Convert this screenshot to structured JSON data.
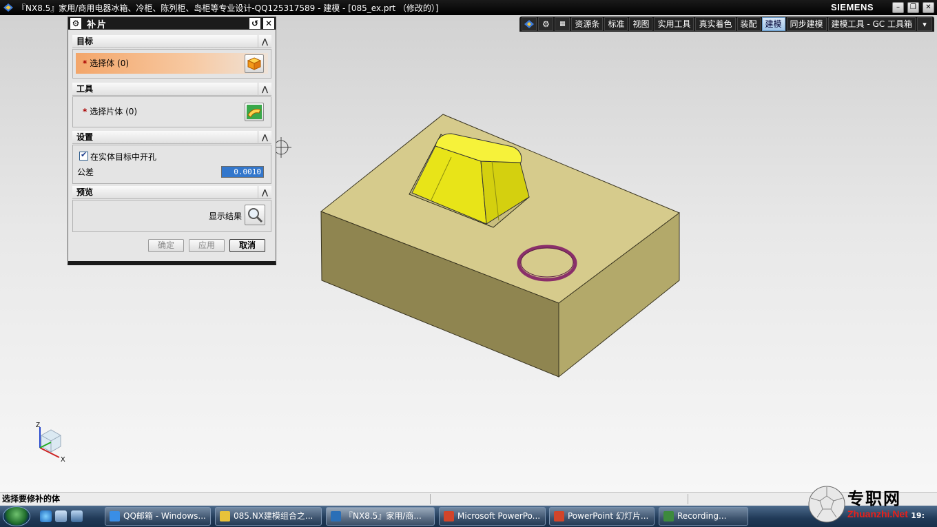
{
  "window": {
    "title": "『NX8.5』家用/商用电器冰箱、冷柜、陈列柜、岛柜等专业设计-QQ125317589 - 建模 - [085_ex.prt （修改的）]",
    "brand": "SIEMENS",
    "buttons": [
      "minimize",
      "restore",
      "close"
    ]
  },
  "ribbon": {
    "tabs": [
      "资源条",
      "标准",
      "视图",
      "实用工具",
      "真实着色",
      "装配",
      "建模",
      "同步建模",
      "建模工具 - GC 工具箱"
    ],
    "active_tab": "建模"
  },
  "dialog": {
    "title": "补片",
    "sections": {
      "target": {
        "header": "目标",
        "select_label": "选择体 (0)"
      },
      "tool": {
        "header": "工具",
        "select_label": "选择片体 (0)"
      },
      "settings": {
        "header": "设置",
        "checkbox_label": "在实体目标中开孔",
        "checkbox_checked": true,
        "tolerance_label": "公差",
        "tolerance_value": "0.0010"
      },
      "preview": {
        "header": "预览",
        "show_result_label": "显示结果"
      }
    },
    "required_mark": "*",
    "buttons": {
      "ok": "确定",
      "apply": "应用",
      "cancel": "取消"
    }
  },
  "status": {
    "prompt": "选择要修补的体"
  },
  "triad": {
    "z": "Z",
    "x": "X"
  },
  "taskbar": {
    "items": [
      {
        "label": "QQ邮箱 - Windows...",
        "color": "#3a8ee6"
      },
      {
        "label": "085.NX建模组合之...",
        "color": "#e8c23a"
      },
      {
        "label": "『NX8.5』家用/商...",
        "color": "#2b6fb7"
      },
      {
        "label": "Microsoft PowerPo...",
        "color": "#d2452a"
      },
      {
        "label": "PowerPoint 幻灯片...",
        "color": "#d2452a"
      },
      {
        "label": "Recording...",
        "color": "#3d8a3d"
      }
    ],
    "active_index": 2,
    "clock": "19:"
  },
  "watermark": {
    "text": "专职网",
    "url": "Zhuanzhi.Net"
  },
  "colors": {
    "block_top": "#d6cb8c",
    "block_front": "#8f8550",
    "block_side": "#b5aa6c",
    "patch_yellow": "#f0ec1a",
    "ring": "#8a2f6a",
    "accent": "#9fc3e6"
  }
}
